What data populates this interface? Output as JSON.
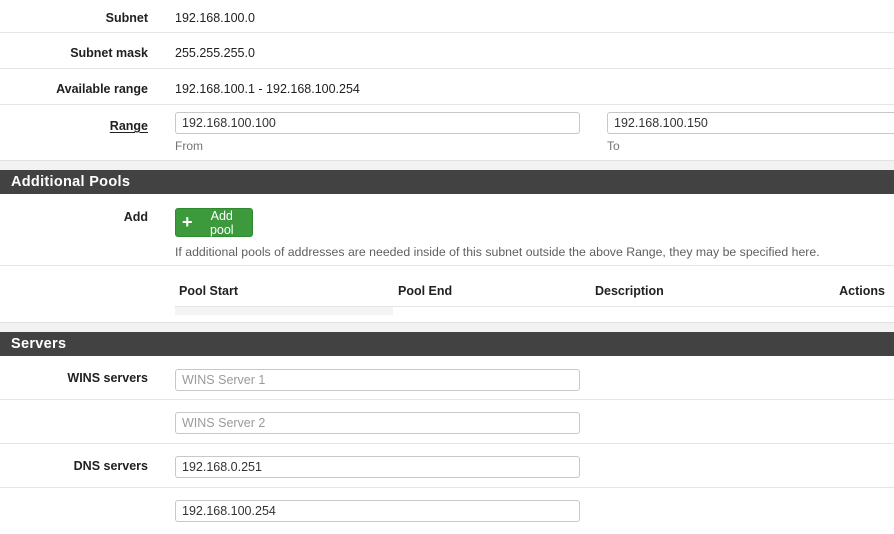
{
  "subnet_section": {
    "subnet": {
      "label": "Subnet",
      "value": "192.168.100.0"
    },
    "subnet_mask": {
      "label": "Subnet mask",
      "value": "255.255.255.0"
    },
    "available_range": {
      "label": "Available range",
      "value": "192.168.100.1 - 192.168.100.254"
    },
    "range": {
      "label": "Range",
      "from_value": "192.168.100.100",
      "from_help": "From",
      "to_value": "192.168.100.150",
      "to_help": "To"
    }
  },
  "additional_pools": {
    "title": "Additional Pools",
    "add_label": "Add",
    "add_button_label": "Add pool",
    "help_text": "If additional pools of addresses are needed inside of this subnet outside the above Range, they may be specified here.",
    "columns": [
      "Pool Start",
      "Pool End",
      "Description",
      "Actions"
    ]
  },
  "servers": {
    "title": "Servers",
    "wins_label": "WINS servers",
    "wins1_placeholder": "WINS Server 1",
    "wins2_placeholder": "WINS Server 2",
    "dns_label": "DNS servers",
    "dns1_value": "192.168.0.251",
    "dns2_value": "192.168.100.254"
  },
  "colors": {
    "section_header_bg": "#424242",
    "add_button_green": "#3c9a3c"
  }
}
